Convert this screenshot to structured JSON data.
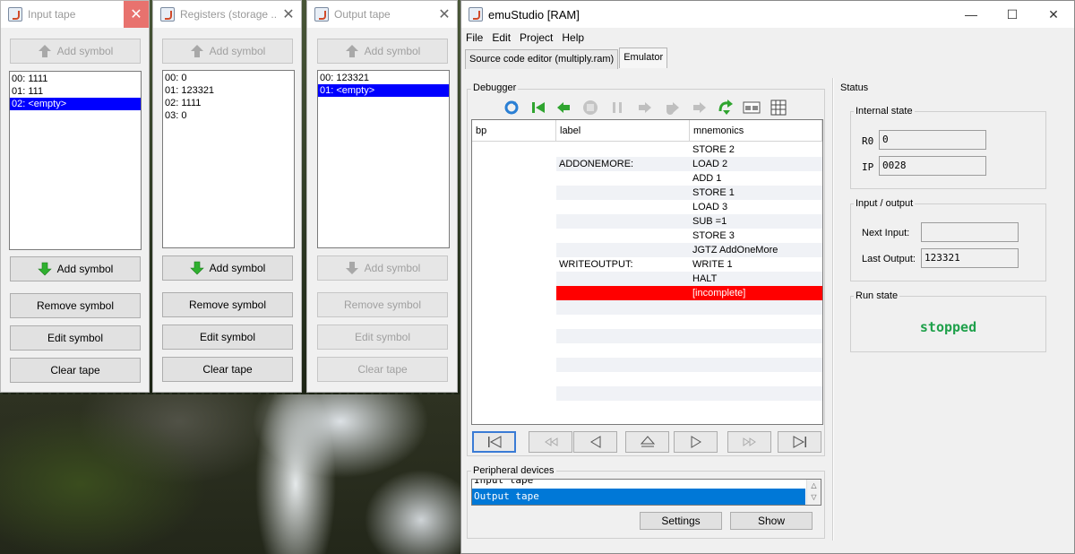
{
  "colors": {
    "selection": "#0000ff",
    "error_row": "#ff0000",
    "run_state": "#1ea04a",
    "peripheral_selection": "#0078d7",
    "add_arrow": "#2fb02f"
  },
  "input_tape": {
    "title": "Input tape",
    "add_symbol_top": "Add symbol",
    "items": [
      "00: 1111",
      "01: 111",
      "02: <empty>"
    ],
    "add_symbol_bottom": "Add symbol",
    "remove_symbol": "Remove symbol",
    "edit_symbol": "Edit symbol",
    "clear_tape": "Clear tape"
  },
  "registers": {
    "title": "Registers (storage ...",
    "add_symbol_top": "Add symbol",
    "items": [
      "00: 0",
      "01: 123321",
      "02: 1111",
      "03: 0"
    ],
    "add_symbol_bottom": "Add symbol",
    "remove_symbol": "Remove symbol",
    "edit_symbol": "Edit symbol",
    "clear_tape": "Clear tape"
  },
  "output_tape": {
    "title": "Output tape",
    "add_symbol_top": "Add symbol",
    "items": [
      "00: 123321",
      "01: <empty>"
    ],
    "add_symbol_bottom": "Add symbol",
    "remove_symbol": "Remove symbol",
    "edit_symbol": "Edit symbol",
    "clear_tape": "Clear tape"
  },
  "main": {
    "title": "emuStudio [RAM]",
    "window_controls": [
      "—",
      "☐",
      "✕"
    ],
    "menu": [
      "File",
      "Edit",
      "Project",
      "Help"
    ],
    "tabs": [
      "Source code editor (multiply.ram)",
      "Emulator"
    ],
    "debugger_label": "Debugger",
    "columns": [
      "bp",
      "label",
      "mnemonics"
    ],
    "rows": [
      {
        "label": "",
        "mnemonic": "STORE 2"
      },
      {
        "label": "ADDONEMORE:",
        "mnemonic": "LOAD 2"
      },
      {
        "label": "",
        "mnemonic": "ADD 1"
      },
      {
        "label": "",
        "mnemonic": "STORE 1"
      },
      {
        "label": "",
        "mnemonic": "LOAD 3"
      },
      {
        "label": "",
        "mnemonic": "SUB =1"
      },
      {
        "label": "",
        "mnemonic": "STORE 3"
      },
      {
        "label": "",
        "mnemonic": "JGTZ AddOneMore"
      },
      {
        "label": "WRITEOUTPUT:",
        "mnemonic": "WRITE 1"
      },
      {
        "label": "",
        "mnemonic": "HALT"
      },
      {
        "label": "",
        "mnemonic": "[incomplete]"
      }
    ],
    "peripheral_label": "Peripheral devices",
    "peripherals": [
      "Input tape",
      "Output tape"
    ],
    "settings_button": "Settings",
    "show_button": "Show",
    "status": {
      "label": "Status",
      "internal_state_label": "Internal state",
      "r0_label": "R0",
      "r0_value": "0",
      "ip_label": "IP",
      "ip_value": "0028",
      "io_label": "Input / output",
      "next_input_label": "Next Input:",
      "next_input_value": "",
      "last_output_label": "Last Output:",
      "last_output_value": "123321",
      "run_state_label": "Run state",
      "run_state_value": "stopped"
    }
  }
}
